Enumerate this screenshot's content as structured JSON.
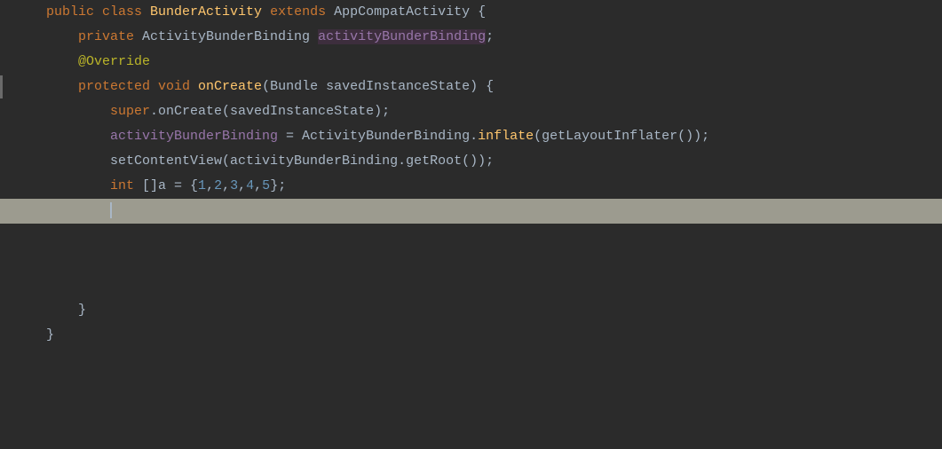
{
  "editor": {
    "background": "#2b2b2b",
    "lines": [
      {
        "number": null,
        "tokens": [
          {
            "text": "public ",
            "class": "kw-public"
          },
          {
            "text": "class ",
            "class": "kw-class"
          },
          {
            "text": "BunderActivity ",
            "class": "class-highlight"
          },
          {
            "text": "extends ",
            "class": "kw-extends"
          },
          {
            "text": "AppCompatActivity {",
            "class": "plain"
          }
        ],
        "highlighted": false,
        "active": false,
        "indicator": null
      },
      {
        "number": null,
        "tokens": [
          {
            "text": "    "
          },
          {
            "text": "private ",
            "class": "kw-private"
          },
          {
            "text": "ActivityBunderBinding ",
            "class": "plain"
          },
          {
            "text": "activityBunderBinding",
            "class": "var-binding-highlight"
          },
          {
            "text": ";",
            "class": "plain"
          }
        ],
        "highlighted": false,
        "active": false,
        "indicator": null
      },
      {
        "number": null,
        "tokens": [
          {
            "text": "    "
          },
          {
            "text": "@Override",
            "class": "annotation"
          }
        ],
        "highlighted": false,
        "active": false,
        "indicator": null
      },
      {
        "number": null,
        "tokens": [
          {
            "text": "    "
          },
          {
            "text": "protected ",
            "class": "kw-protected"
          },
          {
            "text": "void ",
            "class": "kw-void"
          },
          {
            "text": "onCreate",
            "class": "method-name"
          },
          {
            "text": "(",
            "class": "plain"
          },
          {
            "text": "Bundle ",
            "class": "plain"
          },
          {
            "text": "savedInstanceState",
            "class": "plain"
          },
          {
            "text": ") {",
            "class": "plain"
          }
        ],
        "highlighted": false,
        "active": false,
        "indicator": "left"
      },
      {
        "number": null,
        "tokens": [
          {
            "text": "        "
          },
          {
            "text": "super",
            "class": "kw-super"
          },
          {
            "text": ".onCreate(savedInstanceState);",
            "class": "plain"
          }
        ],
        "highlighted": false,
        "active": false,
        "indicator": null
      },
      {
        "number": null,
        "tokens": [
          {
            "text": "        "
          },
          {
            "text": "activityBunderBinding",
            "class": "var-binding"
          },
          {
            "text": " = ActivityBunderBinding.",
            "class": "plain"
          },
          {
            "text": "inflate",
            "class": "method-name"
          },
          {
            "text": "(getLayoutInflater());",
            "class": "plain"
          }
        ],
        "highlighted": false,
        "active": false,
        "indicator": null
      },
      {
        "number": null,
        "tokens": [
          {
            "text": "        "
          },
          {
            "text": "setContentView(activityBunderBinding.getRoot());",
            "class": "plain"
          }
        ],
        "highlighted": false,
        "active": false,
        "indicator": null
      },
      {
        "number": null,
        "tokens": [
          {
            "text": "        "
          },
          {
            "text": "int ",
            "class": "kw-int"
          },
          {
            "text": "[]a = {",
            "class": "plain"
          },
          {
            "text": "1",
            "class": "number"
          },
          {
            "text": ",",
            "class": "plain"
          },
          {
            "text": "2",
            "class": "number"
          },
          {
            "text": ",",
            "class": "plain"
          },
          {
            "text": "3",
            "class": "number"
          },
          {
            "text": ",",
            "class": "plain"
          },
          {
            "text": "4",
            "class": "number"
          },
          {
            "text": ",",
            "class": "plain"
          },
          {
            "text": "5",
            "class": "number"
          },
          {
            "text": "};",
            "class": "plain"
          }
        ],
        "highlighted": false,
        "active": false,
        "indicator": null
      },
      {
        "number": null,
        "tokens": [
          {
            "text": "        "
          },
          {
            "text": "CURSOR",
            "class": "cursor-placeholder"
          }
        ],
        "highlighted": true,
        "active": true,
        "indicator": null
      },
      {
        "number": null,
        "tokens": [],
        "highlighted": false,
        "active": false,
        "indicator": null
      },
      {
        "number": null,
        "tokens": [],
        "highlighted": false,
        "active": false,
        "indicator": null
      },
      {
        "number": null,
        "tokens": [],
        "highlighted": false,
        "active": false,
        "indicator": null
      },
      {
        "number": null,
        "tokens": [
          {
            "text": "    "
          },
          {
            "text": "}",
            "class": "plain"
          }
        ],
        "highlighted": false,
        "active": false,
        "indicator": null
      },
      {
        "number": null,
        "tokens": [
          {
            "text": "}",
            "class": "plain"
          }
        ],
        "highlighted": false,
        "active": false,
        "indicator": null
      }
    ]
  }
}
